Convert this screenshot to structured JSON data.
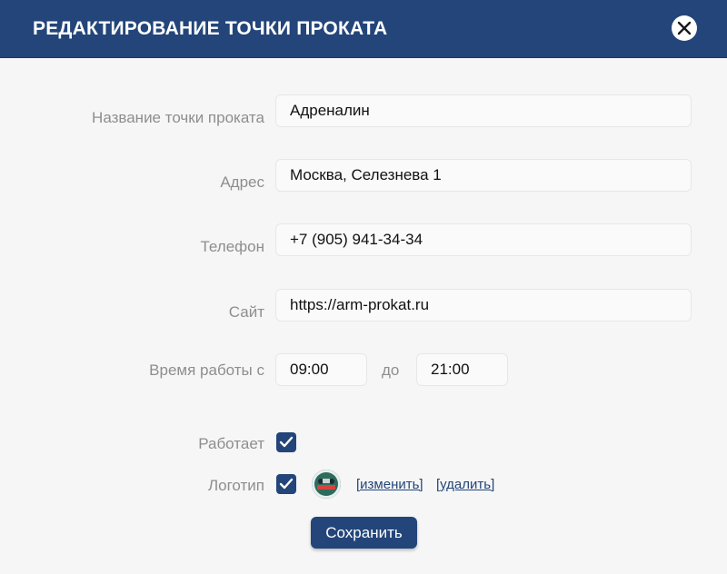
{
  "dialog": {
    "title": "РЕДАКТИРОВАНИЕ ТОЧКИ ПРОКАТА",
    "close_icon": "close-icon"
  },
  "form": {
    "name": {
      "label": "Название точки проката",
      "value": "Адреналин"
    },
    "address": {
      "label": "Адрес",
      "value": "Москва, Селезнева 1"
    },
    "phone": {
      "label": "Телефон",
      "value": "+7 (905) 941-34-34"
    },
    "site": {
      "label": "Сайт",
      "value": "https://arm-prokat.ru"
    },
    "hours": {
      "label": "Время работы с",
      "from": "09:00",
      "to_label": "до",
      "to": "21:00"
    },
    "working": {
      "label": "Работает",
      "checked": true
    },
    "logo": {
      "label": "Логотип",
      "checked": true,
      "change_link": "[изменить]",
      "delete_link": "[удалить]"
    },
    "save_label": "Сохранить"
  },
  "colors": {
    "accent": "#234579",
    "label": "#8e8e8e",
    "background": "#f6f6f6"
  }
}
